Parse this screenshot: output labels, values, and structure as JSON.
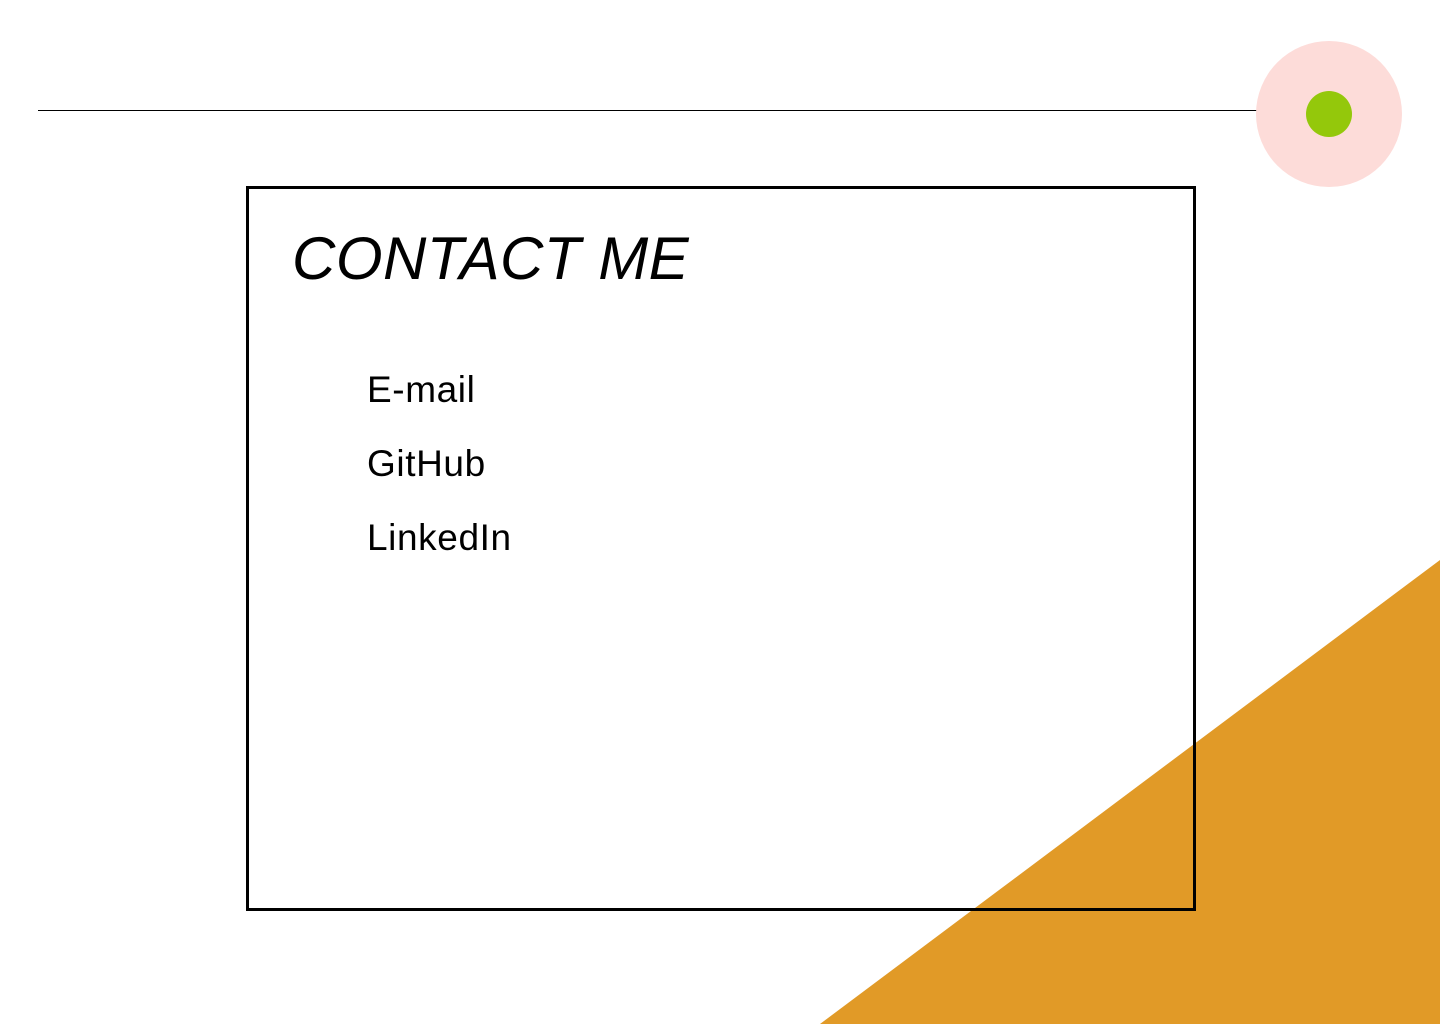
{
  "colors": {
    "background": "#ffffff",
    "rule": "#000000",
    "menu_ring": "#fddcd9",
    "menu_dot": "#94c80b",
    "triangle": "#e19a27",
    "card_border": "#000000"
  },
  "contact": {
    "title": "CONTACT ME",
    "links": [
      {
        "label": "E-mail"
      },
      {
        "label": "GitHub"
      },
      {
        "label": "LinkedIn"
      }
    ]
  }
}
